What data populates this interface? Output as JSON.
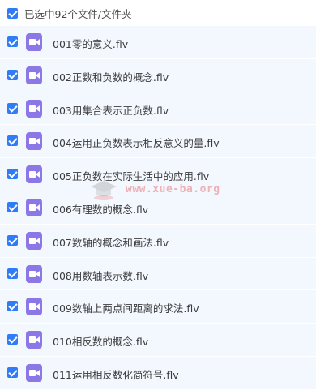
{
  "header": {
    "selection_label": "已选中92个文件/文件夹",
    "checked": true
  },
  "files": [
    {
      "name": "001零的意义.flv",
      "checked": true
    },
    {
      "name": "002正数和负数的概念.flv",
      "checked": true
    },
    {
      "name": "003用集合表示正负数.flv",
      "checked": true
    },
    {
      "name": "004运用正负数表示相反意义的量.flv",
      "checked": true
    },
    {
      "name": "005正负数在实际生活中的应用.flv",
      "checked": true
    },
    {
      "name": "006有理数的概念.flv",
      "checked": true
    },
    {
      "name": "007数轴的概念和画法.flv",
      "checked": true
    },
    {
      "name": "008用数轴表示数.flv",
      "checked": true
    },
    {
      "name": "009数轴上两点间距离的求法.flv",
      "checked": true
    },
    {
      "name": "010相反数的概念.flv",
      "checked": true
    },
    {
      "name": "011运用相反数化简符号.flv",
      "checked": true
    }
  ],
  "icons": {
    "checkbox": "checkbox-checked-icon",
    "file_type": "video-file-icon"
  },
  "colors": {
    "checkbox": "#2f7df6",
    "video_icon": "#8b78e6",
    "row_background": "#f3f8ff",
    "watermark": "#e87878"
  },
  "watermark": {
    "text": "www.xue-ba.org"
  }
}
